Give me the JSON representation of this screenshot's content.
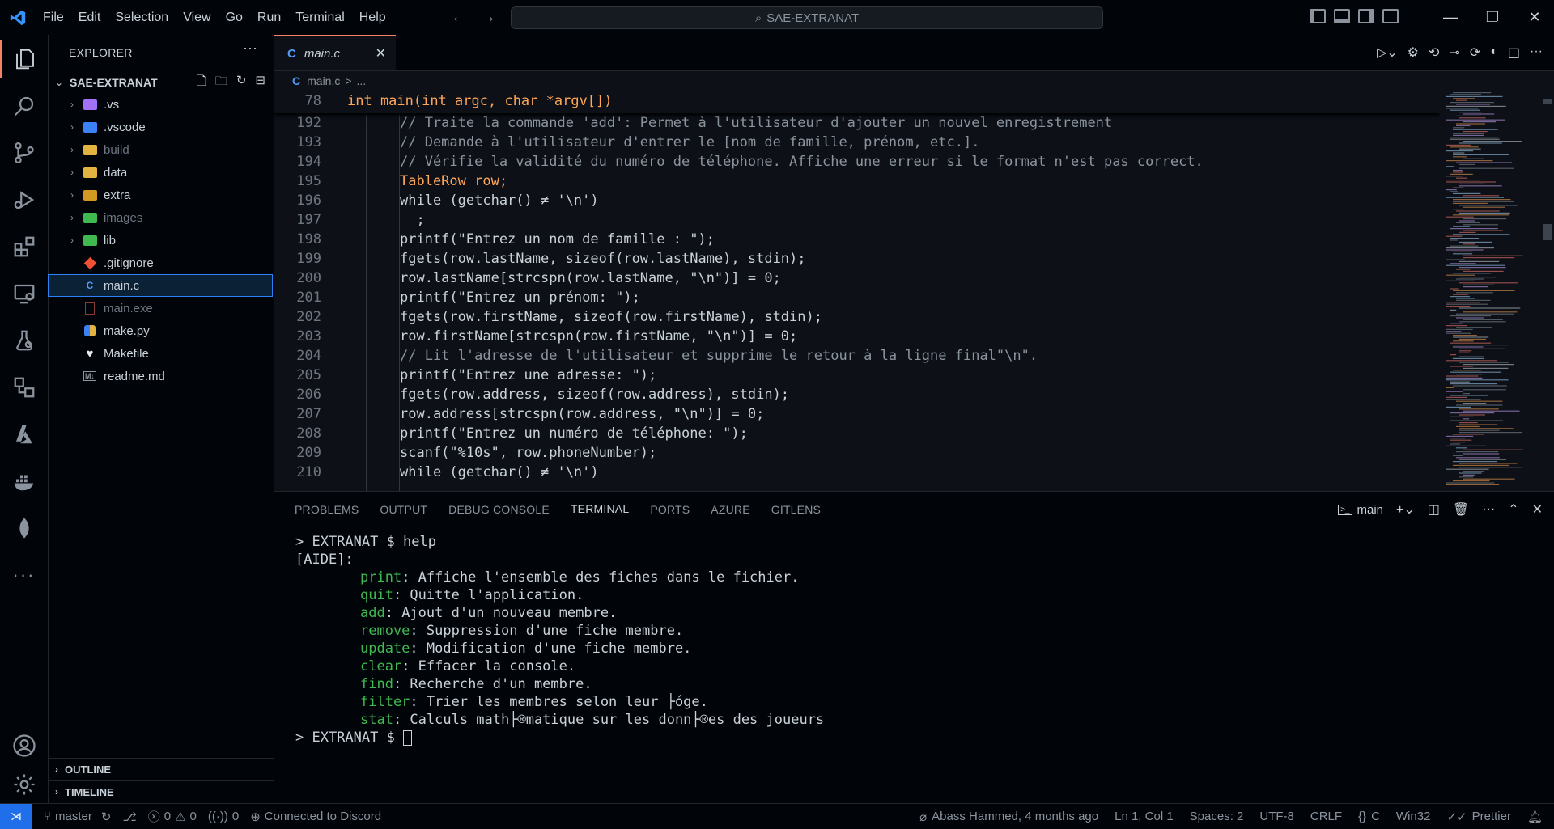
{
  "window": {
    "title": "SAE-EXTRANAT"
  },
  "menu": [
    "File",
    "Edit",
    "Selection",
    "View",
    "Go",
    "Run",
    "Terminal",
    "Help"
  ],
  "sidebar": {
    "title": "EXPLORER",
    "project": "SAE-EXTRANAT",
    "items": [
      {
        "label": ".vs",
        "type": "folder",
        "color": "#a371f7"
      },
      {
        "label": ".vscode",
        "type": "folder",
        "color": "#3b82f6"
      },
      {
        "label": "build",
        "type": "folder",
        "color": "#e3b341"
      },
      {
        "label": "data",
        "type": "folder",
        "color": "#e3b341"
      },
      {
        "label": "extra",
        "type": "folder",
        "color": "#d29922"
      },
      {
        "label": "images",
        "type": "folder",
        "color": "#3fb950"
      },
      {
        "label": "lib",
        "type": "folder",
        "color": "#3fb950"
      },
      {
        "label": ".gitignore",
        "type": "file",
        "icon": "git-icon"
      },
      {
        "label": "main.c",
        "type": "file",
        "icon": "c-file-icon",
        "selected": true
      },
      {
        "label": "main.exe",
        "type": "file",
        "icon": "exe-file-icon",
        "dim": true
      },
      {
        "label": "make.py",
        "type": "file",
        "icon": "python-file-icon"
      },
      {
        "label": "Makefile",
        "type": "file",
        "icon": "makefile-icon"
      },
      {
        "label": "readme.md",
        "type": "file",
        "icon": "markdown-file-icon"
      }
    ],
    "outline": "OUTLINE",
    "timeline": "TIMELINE"
  },
  "editor": {
    "tab": "main.c",
    "breadcrumb": {
      "file": "main.c",
      "sep": ">",
      "rest": "..."
    },
    "sticky": {
      "line": "78",
      "code": "int main(int argc, char *argv[])"
    },
    "lines": [
      {
        "n": "192",
        "text": "// Traite la commande 'add': Permet à l'utilisateur d'ajouter un nouvel enregistrement"
      },
      {
        "n": "193",
        "text": "// Demande à l'utilisateur d'entrer le [nom de famille, prénom, etc.]."
      },
      {
        "n": "194",
        "text": "// Vérifie la validité du numéro de téléphone. Affiche une erreur si le format n'est pas correct."
      },
      {
        "n": "195",
        "text": "TableRow row;"
      },
      {
        "n": "196",
        "text": "while (getchar() ≠ '\\n')"
      },
      {
        "n": "197",
        "text": "  ;"
      },
      {
        "n": "198",
        "text": "printf(\"Entrez un nom de famille : \");"
      },
      {
        "n": "199",
        "text": "fgets(row.lastName, sizeof(row.lastName), stdin);"
      },
      {
        "n": "200",
        "text": "row.lastName[strcspn(row.lastName, \"\\n\")] = 0;"
      },
      {
        "n": "201",
        "text": "printf(\"Entrez un prénom: \");"
      },
      {
        "n": "202",
        "text": "fgets(row.firstName, sizeof(row.firstName), stdin);"
      },
      {
        "n": "203",
        "text": "row.firstName[strcspn(row.firstName, \"\\n\")] = 0;"
      },
      {
        "n": "204",
        "text": "// Lit l'adresse de l'utilisateur et supprime le retour à la ligne final\"\\n\"."
      },
      {
        "n": "205",
        "text": "printf(\"Entrez une adresse: \");"
      },
      {
        "n": "206",
        "text": "fgets(row.address, sizeof(row.address), stdin);"
      },
      {
        "n": "207",
        "text": "row.address[strcspn(row.address, \"\\n\")] = 0;"
      },
      {
        "n": "208",
        "text": "printf(\"Entrez un numéro de téléphone: \");"
      },
      {
        "n": "209",
        "text": "scanf(\"%10s\", row.phoneNumber);"
      },
      {
        "n": "210",
        "text": "while (getchar() ≠ '\\n')"
      }
    ]
  },
  "panel": {
    "tabs": [
      "PROBLEMS",
      "OUTPUT",
      "DEBUG CONSOLE",
      "TERMINAL",
      "PORTS",
      "AZURE",
      "GITLENS"
    ],
    "active_tab": "TERMINAL",
    "terminal_name": "main",
    "terminal": {
      "prompt1": "> EXTRANAT $ help",
      "header": "[AIDE]:",
      "commands": [
        {
          "cmd": "print",
          "desc": ": Affiche l'ensemble des fiches dans le fichier."
        },
        {
          "cmd": "quit",
          "desc": ": Quitte l'application."
        },
        {
          "cmd": "add",
          "desc": ": Ajout d'un nouveau membre."
        },
        {
          "cmd": "remove",
          "desc": ": Suppression d'une fiche membre."
        },
        {
          "cmd": "update",
          "desc": ": Modification d'une fiche membre."
        },
        {
          "cmd": "clear",
          "desc": ": Effacer la console."
        },
        {
          "cmd": "find",
          "desc": ": Recherche d'un membre."
        },
        {
          "cmd": "filter",
          "desc": ": Trier les membres selon leur ├óge."
        },
        {
          "cmd": "stat",
          "desc": ": Calculs math├®matique sur les donn├®es des joueurs"
        }
      ],
      "prompt2": "> EXTRANAT $ "
    }
  },
  "statusbar": {
    "branch": "master",
    "errors": "0",
    "warnings": "0",
    "ports": "0",
    "discord": "Connected to Discord",
    "blame": "Abass Hammed, 4 months ago",
    "position": "Ln 1, Col 1",
    "spaces": "Spaces: 2",
    "encoding": "UTF-8",
    "eol": "CRLF",
    "language": "C",
    "platform": "Win32",
    "formatter": "Prettier"
  },
  "colors": {
    "accent": "#f78166",
    "background": "#0d1117",
    "chrome": "#010409",
    "remote": "#1f6feb",
    "terminal_cmd": "#3fb950"
  }
}
